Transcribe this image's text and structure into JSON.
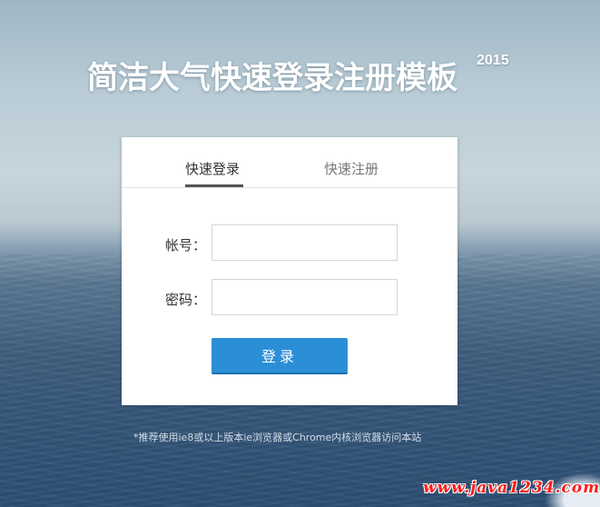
{
  "header": {
    "title": "简洁大气快速登录注册模板",
    "year": "2015"
  },
  "tabs": [
    {
      "label": "快速登录",
      "active": true
    },
    {
      "label": "快速注册",
      "active": false
    }
  ],
  "form": {
    "account_label": "帐号：",
    "account_value": "",
    "password_label": "密码：",
    "password_value": "",
    "submit_label": "登录"
  },
  "footer": {
    "note": "*推荐使用ie8或以上版本ie浏览器或Chrome内核浏览器访问本站"
  },
  "watermark": "www.java1234.com",
  "colors": {
    "button": "#2b8fd8",
    "watermark": "#ff1a1a"
  }
}
